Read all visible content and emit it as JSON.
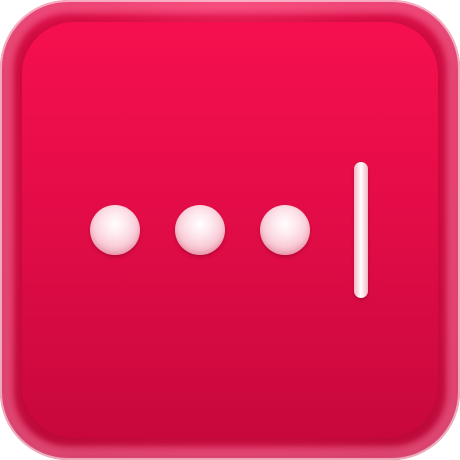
{
  "app_icon": {
    "name": "",
    "icon": "password-dots-cursor-icon",
    "masked_characters": 3,
    "colors": {
      "background": "#e60c4a",
      "background_dark": "#c8083d",
      "glow": "#ff9fbe",
      "dots": "#f8c8d4",
      "cursor": "#ffffff"
    }
  }
}
